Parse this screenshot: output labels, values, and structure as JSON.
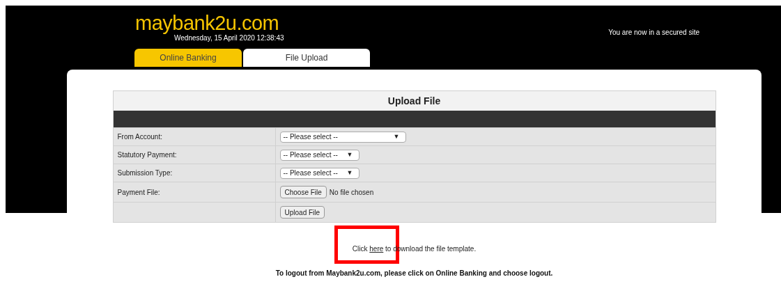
{
  "header": {
    "logo": "maybank2u.com",
    "datetime": "Wednesday, 15 April 2020 12:38:43",
    "secure_notice": "You are now in a secured site"
  },
  "tabs": [
    {
      "label": "Online Banking",
      "selected": false
    },
    {
      "label": "File Upload",
      "selected": true
    }
  ],
  "form": {
    "title": "Upload File",
    "rows": [
      {
        "kind": "select",
        "label": "From Account:",
        "value": "-- Please select --",
        "caret": "▼",
        "wide": true
      },
      {
        "kind": "select",
        "label": "Statutory Payment:",
        "value": "-- Please select --",
        "caret": "▼",
        "wide": false
      },
      {
        "kind": "select",
        "label": "Submission Type:",
        "value": "-- Please select --",
        "caret": "▼",
        "wide": false
      },
      {
        "kind": "file",
        "label": "Payment File:",
        "button": "Choose File",
        "status": "No file chosen"
      },
      {
        "kind": "submit",
        "button": "Upload File"
      }
    ]
  },
  "template_note": {
    "before": "Click ",
    "link": "here",
    "after": " to download the file template."
  },
  "logout_note": "To logout from Maybank2u.com, please click on Online Banking and choose logout."
}
